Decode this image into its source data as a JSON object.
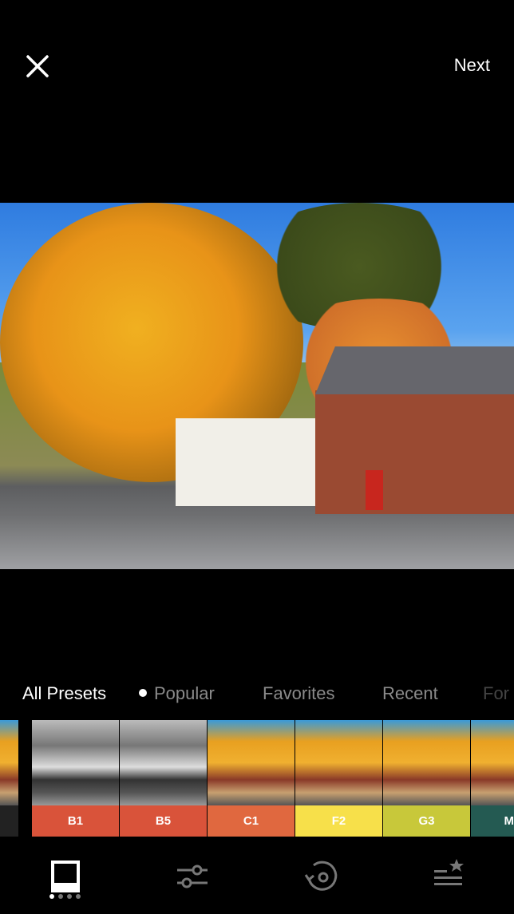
{
  "header": {
    "close_icon": "close-x-icon",
    "next_label": "Next"
  },
  "tabs": [
    {
      "label": "All Presets",
      "active": true
    },
    {
      "label": "Popular",
      "active": false,
      "dot": true
    },
    {
      "label": "Favorites",
      "active": false
    },
    {
      "label": "Recent",
      "active": false
    },
    {
      "label": "For",
      "active": false
    }
  ],
  "presets": [
    {
      "label": "",
      "color": "#222222",
      "style": "color"
    },
    {
      "label": "B1",
      "color": "#d9533a",
      "style": "bw"
    },
    {
      "label": "B5",
      "color": "#d9533a",
      "style": "bw"
    },
    {
      "label": "C1",
      "color": "#e0683f",
      "style": "color"
    },
    {
      "label": "F2",
      "color": "#f7e04a",
      "style": "color"
    },
    {
      "label": "G3",
      "color": "#c8c83a",
      "style": "color"
    },
    {
      "label": "M",
      "color": "#245a52",
      "style": "color"
    }
  ],
  "bottom_nav": [
    {
      "icon": "presets-frame-icon",
      "active": true
    },
    {
      "icon": "adjust-sliders-icon",
      "active": false
    },
    {
      "icon": "history-revert-icon",
      "active": false
    },
    {
      "icon": "recipes-star-list-icon",
      "active": false
    }
  ],
  "page_indicator": {
    "count": 4,
    "current": 1
  }
}
